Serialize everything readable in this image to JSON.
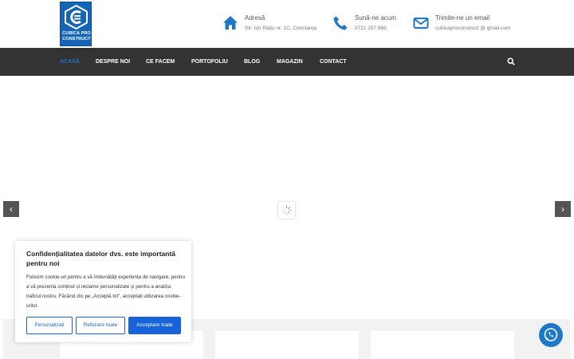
{
  "brand": {
    "name_line1": "CUBICA PRO",
    "name_line2": "CONSTRUCT",
    "color": "#1565b6"
  },
  "header": {
    "address": {
      "icon": "home-icon",
      "title": "Adresă",
      "value": "Str. Ion Rațiu nr. 1C, Constanța"
    },
    "phone": {
      "icon": "phone-icon",
      "title": "Sună-ne acum",
      "value": "0721 157 869"
    },
    "email": {
      "icon": "envelope-icon",
      "title": "Trimite-ne un email",
      "value": "cubicaproconstruct @ gmail.com"
    }
  },
  "nav": {
    "items": [
      {
        "label": "ACASĂ",
        "active": true
      },
      {
        "label": "DESPRE NOI"
      },
      {
        "label": "CE FACEM"
      },
      {
        "label": "PORTOFOLIU"
      },
      {
        "label": "BLOG"
      },
      {
        "label": "MAGAZIN"
      },
      {
        "label": "CONTACT"
      }
    ],
    "search_icon": "search-icon",
    "bg_color": "#333333",
    "active_color": "#1e78c8"
  },
  "slider": {
    "prev": "‹",
    "next": "›"
  },
  "cookie": {
    "title": "Confidențialitatea datelor dvs. este importantă pentru noi",
    "text": "Folosim cookie-uri pentru a vă îmbunătăți experiența de navigare, pentru a vă prezenta conținut și reclame personalizate și pentru a analiza traficul nostru. Făcând clic pe „Acceptă tot”, acceptați utilizarea cookie-urilor.",
    "customize_label": "Personalizați",
    "reject_label": "Refuzare toate",
    "accept_label": "Acceptare toate",
    "accent": "#1863dc"
  },
  "whatsapp": {
    "icon": "whatsapp-icon"
  }
}
